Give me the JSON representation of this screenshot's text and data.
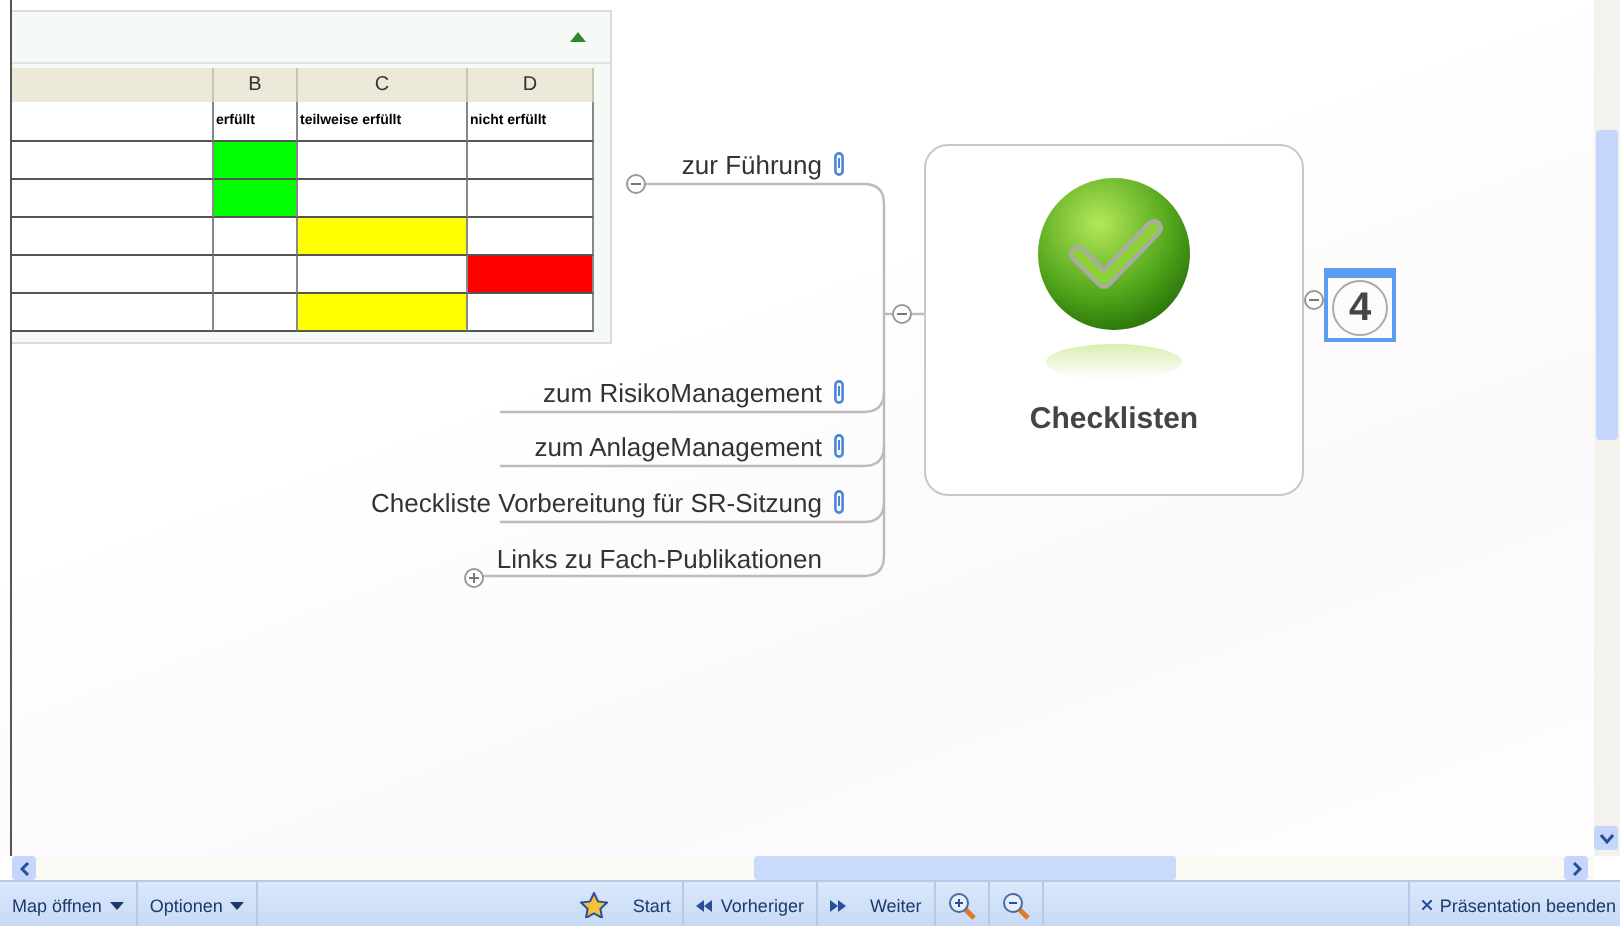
{
  "sheet": {
    "columns": [
      "B",
      "C",
      "D"
    ],
    "headers": [
      "erfüllt",
      "teilweise erfüllt",
      "nicht erfüllt"
    ],
    "rows": [
      {
        "cells": [
          {
            "color": "#00ff00"
          },
          {
            "color": "#ffffff"
          },
          {
            "color": "#ffffff"
          }
        ]
      },
      {
        "cells": [
          {
            "color": "#00ff00"
          },
          {
            "color": "#ffffff"
          },
          {
            "color": "#ffffff"
          }
        ]
      },
      {
        "cells": [
          {
            "color": "#ffffff"
          },
          {
            "color": "#ffff00"
          },
          {
            "color": "#ffffff"
          }
        ]
      },
      {
        "cells": [
          {
            "color": "#ffffff"
          },
          {
            "color": "#ffffff"
          },
          {
            "color": "#ff0000"
          }
        ]
      },
      {
        "cells": [
          {
            "color": "#ffffff"
          },
          {
            "color": "#ffff00"
          },
          {
            "color": "#ffffff"
          }
        ]
      }
    ]
  },
  "topics": [
    {
      "label": "zur Führung",
      "attachment": true,
      "expanded": true
    },
    {
      "label": "zum RisikoManagement",
      "attachment": true
    },
    {
      "label": "zum AnlageManagement",
      "attachment": true
    },
    {
      "label": "Checkliste Vorbereitung für SR-Sitzung",
      "attachment": true
    },
    {
      "label": "Links zu Fach-Publikationen",
      "attachment": false,
      "expanded": false
    }
  ],
  "central": {
    "title": "Checklisten",
    "expanded": true
  },
  "child": {
    "label": "4",
    "selected": true
  },
  "toolbar": [
    {
      "kind": "menu",
      "label": "Map öffnen"
    },
    {
      "kind": "menu",
      "label": "Optionen"
    },
    {
      "kind": "start",
      "label": "Start"
    },
    {
      "kind": "prev",
      "label": "Vorheriger"
    },
    {
      "kind": "next",
      "label": "Weiter"
    },
    {
      "kind": "zoom-in"
    },
    {
      "kind": "zoom-out"
    },
    {
      "kind": "end",
      "label": "Präsentation beenden"
    }
  ]
}
